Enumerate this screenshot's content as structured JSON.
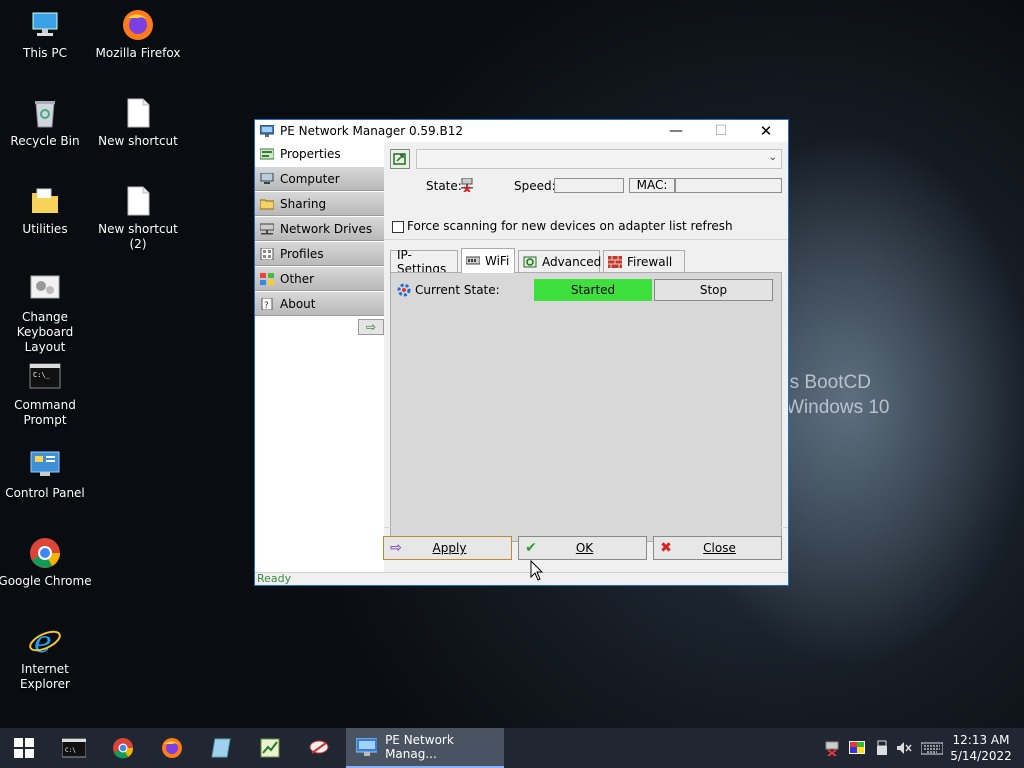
{
  "desktop": {
    "icons": [
      {
        "label": "This PC",
        "icon": "computer-icon"
      },
      {
        "label": "Mozilla Firefox",
        "icon": "firefox-icon"
      },
      {
        "label": "Recycle Bin",
        "icon": "recycle-bin-icon"
      },
      {
        "label": "New shortcut",
        "icon": "file-icon"
      },
      {
        "label": "Utilities",
        "icon": "folder-icon"
      },
      {
        "label": "New shortcut (2)",
        "icon": "file-icon"
      },
      {
        "label": "Change Keyboard Layout",
        "icon": "keyboard-layout-icon"
      },
      {
        "label": "Command Prompt",
        "icon": "cmd-icon"
      },
      {
        "label": "Control Panel",
        "icon": "control-panel-icon"
      },
      {
        "label": "Google Chrome",
        "icon": "chrome-icon"
      },
      {
        "label": "Internet Explorer",
        "icon": "ie-icon"
      }
    ],
    "wallpaper_text": [
      "'s BootCD",
      "Windows 10"
    ]
  },
  "window": {
    "title": "PE Network Manager 0.59.B12",
    "controls": {
      "minimize": "—",
      "maximize": "☐",
      "close": "✕"
    },
    "sidebar": {
      "items": [
        {
          "label": "Properties",
          "icon": "properties-icon",
          "active": true
        },
        {
          "label": "Computer",
          "icon": "computer-icon"
        },
        {
          "label": "Sharing",
          "icon": "sharing-folder-icon"
        },
        {
          "label": "Network Drives",
          "icon": "network-drive-icon"
        },
        {
          "label": "Profiles",
          "icon": "profiles-icon"
        },
        {
          "label": "Other",
          "icon": "other-grid-icon"
        },
        {
          "label": "About",
          "icon": "about-icon"
        }
      ],
      "arrow": "⇨"
    },
    "adapter": {
      "selected": "",
      "state_label": "State:",
      "speed_label": "Speed:",
      "speed_value": "",
      "mac_label": "MAC:",
      "mac_value": "",
      "force_scan_label": "Force scanning for new devices on adapter list refresh",
      "force_scan_checked": false
    },
    "tabs": [
      {
        "label": "IP-Settings"
      },
      {
        "label": "WiFi",
        "active": true
      },
      {
        "label": "Advanced"
      },
      {
        "label": "Firewall"
      }
    ],
    "wifi": {
      "current_state_label": "Current State:",
      "state_value": "Started",
      "state_color": "#3ee03e",
      "stop_label": "Stop"
    },
    "buttons": {
      "apply": "Apply",
      "ok": "OK",
      "close": "Close"
    },
    "status": "Ready"
  },
  "taskbar": {
    "active_app": "PE Network Manag...",
    "time": "12:13 AM",
    "date": "5/14/2022"
  },
  "colors": {
    "accent": "#1c6fc4",
    "taskbar": "#202733",
    "status_text": "#3c8a3c"
  }
}
